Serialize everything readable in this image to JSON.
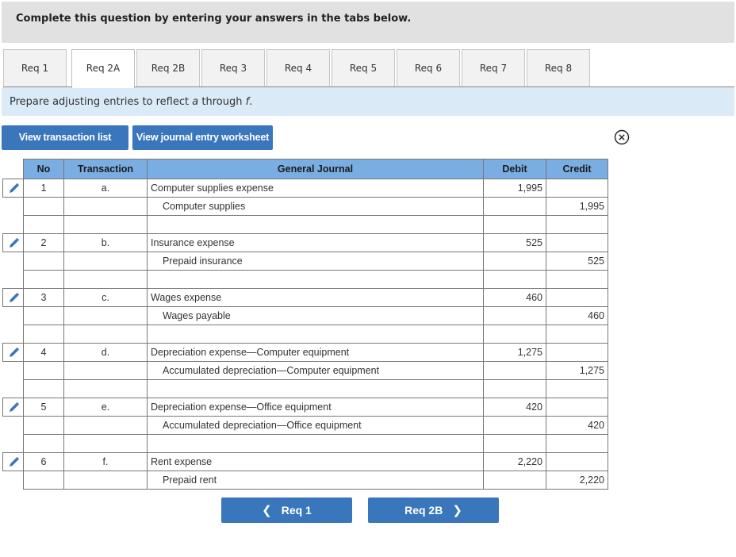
{
  "header": {
    "title": "Complete this question by entering your answers in the tabs below."
  },
  "tabs": [
    {
      "label": "Req 1",
      "active": false
    },
    {
      "label": "Req 2A",
      "active": true
    },
    {
      "label": "Req 2B",
      "active": false
    },
    {
      "label": "Req 3",
      "active": false
    },
    {
      "label": "Req 4",
      "active": false
    },
    {
      "label": "Req 5",
      "active": false
    },
    {
      "label": "Req 6",
      "active": false
    },
    {
      "label": "Req 7",
      "active": false
    },
    {
      "label": "Req 8",
      "active": false
    }
  ],
  "instruction": {
    "prefix": "Prepare adjusting entries to reflect ",
    "from": "a",
    "middle": " through ",
    "to": "f",
    "suffix": "."
  },
  "buttons": {
    "view_transaction_list": "View transaction list",
    "view_journal_worksheet": "View journal entry worksheet"
  },
  "icons": {
    "close": "close-circle-icon",
    "edit": "pencil-icon",
    "prev": "chevron-left-icon",
    "next": "chevron-right-icon"
  },
  "journal": {
    "headers": {
      "no": "No",
      "transaction": "Transaction",
      "general_journal": "General Journal",
      "debit": "Debit",
      "credit": "Credit"
    },
    "entries": [
      {
        "no": "1",
        "transaction": "a.",
        "debit_account": "Computer supplies expense",
        "credit_account": "Computer supplies",
        "debit": "1,995",
        "credit": "1,995"
      },
      {
        "no": "2",
        "transaction": "b.",
        "debit_account": "Insurance expense",
        "credit_account": "Prepaid insurance",
        "debit": "525",
        "credit": "525"
      },
      {
        "no": "3",
        "transaction": "c.",
        "debit_account": "Wages expense",
        "credit_account": "Wages payable",
        "debit": "460",
        "credit": "460"
      },
      {
        "no": "4",
        "transaction": "d.",
        "debit_account": "Depreciation expense—Computer equipment",
        "credit_account": "Accumulated depreciation—Computer equipment",
        "debit": "1,275",
        "credit": "1,275"
      },
      {
        "no": "5",
        "transaction": "e.",
        "debit_account": "Depreciation expense—Office equipment",
        "credit_account": "Accumulated depreciation—Office equipment",
        "debit": "420",
        "credit": "420"
      },
      {
        "no": "6",
        "transaction": "f.",
        "debit_account": "Rent expense",
        "credit_account": "Prepaid rent",
        "debit": "2,220",
        "credit": "2,220"
      }
    ]
  },
  "navigation": {
    "prev_label": "Req 1",
    "next_label": "Req 2B"
  },
  "colors": {
    "accent_button": "#3a76bb",
    "table_header": "#7aaee3",
    "instruction_bg": "#daeaf7",
    "header_bg": "#e1e1e1"
  }
}
